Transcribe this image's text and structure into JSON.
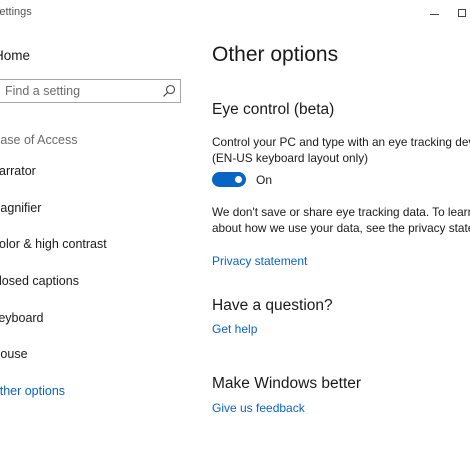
{
  "window": {
    "title": "Settings"
  },
  "sidebar": {
    "home_label": "Home",
    "search_placeholder": "Find a setting",
    "section_title": "Ease of Access",
    "items": [
      {
        "label": "Narrator",
        "active": false
      },
      {
        "label": "Magnifier",
        "active": false
      },
      {
        "label": "Color & high contrast",
        "active": false
      },
      {
        "label": "Closed captions",
        "active": false
      },
      {
        "label": "Keyboard",
        "active": false
      },
      {
        "label": "Mouse",
        "active": false
      },
      {
        "label": "Other options",
        "active": true
      }
    ]
  },
  "main": {
    "page_title": "Other options",
    "eye_control": {
      "heading": "Eye control (beta)",
      "description_line1": "Control your PC and type with an eye tracking device",
      "description_line2": "(EN-US keyboard layout only)",
      "toggle_state": "On",
      "privacy_line1": "We don't save or share eye tracking data. To learn more",
      "privacy_line2": "about how we use your data, see the privacy statement.",
      "privacy_link": "Privacy statement"
    },
    "question": {
      "heading": "Have a question?",
      "link": "Get help"
    },
    "feedback": {
      "heading": "Make Windows better",
      "link": "Give us feedback"
    }
  },
  "colors": {
    "accent": "#0a64c4",
    "text": "#1a1a1a",
    "muted": "#6b6b6b"
  }
}
